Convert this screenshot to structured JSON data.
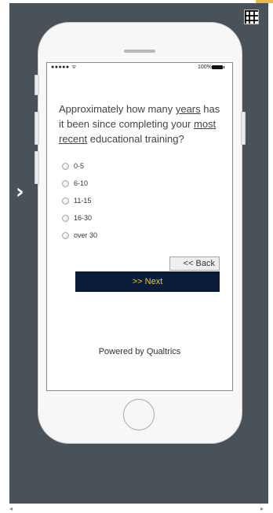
{
  "status_bar": {
    "signal": "●●●●● ᯤ",
    "battery_percent": "100%"
  },
  "survey": {
    "question_part1": "Approximately how many ",
    "question_underline1": "years",
    "question_part2": " has it been since completing your ",
    "question_underline2": "most recent",
    "question_part3": " educational training?",
    "options": [
      "0-5",
      "6-10",
      "11-15",
      "16-30",
      "over 30"
    ],
    "back_label": "<< Back",
    "next_label": ">> Next",
    "powered_by": "Powered by Qualtrics"
  },
  "nav": {
    "next_arrow": "›"
  },
  "scroll": {
    "left_arrow": "◂",
    "right_arrow": "▸"
  },
  "colors": {
    "background": "#4a5259",
    "next_button_bg": "#0b1c3a",
    "next_button_text": "#f3c623"
  }
}
